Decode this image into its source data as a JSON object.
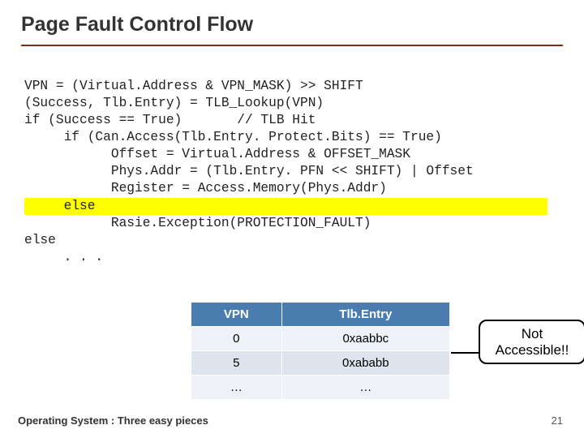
{
  "title": "Page Fault Control Flow",
  "code": {
    "l1": "VPN = (Virtual.Address & VPN_MASK) >> SHIFT",
    "l2": "(Success, Tlb.Entry) = TLB_Lookup(VPN)",
    "l3": "if (Success == True)       // TLB Hit",
    "l4": "     if (Can.Access(Tlb.Entry. Protect.Bits) == True)",
    "l5": "           Offset = Virtual.Address & OFFSET_MASK",
    "l6": "           Phys.Addr = (Tlb.Entry. PFN << SHIFT) | Offset",
    "l7": "           Register = Access.Memory(Phys.Addr)",
    "l8": "     else",
    "l9": "           Rasie.Exception(PROTECTION_FAULT)",
    "l10": "else",
    "l11": "     . . ."
  },
  "table": {
    "headers": {
      "c1": "VPN",
      "c2": "Tlb.Entry"
    },
    "rows": [
      {
        "vpn": "0",
        "entry": "0xaabbc"
      },
      {
        "vpn": "5",
        "entry": "0xababb"
      },
      {
        "vpn": "…",
        "entry": "…"
      }
    ]
  },
  "callout": {
    "l1": "Not",
    "l2": "Accessible!!"
  },
  "footer": {
    "left": "Operating System : Three easy pieces",
    "right": "21"
  }
}
